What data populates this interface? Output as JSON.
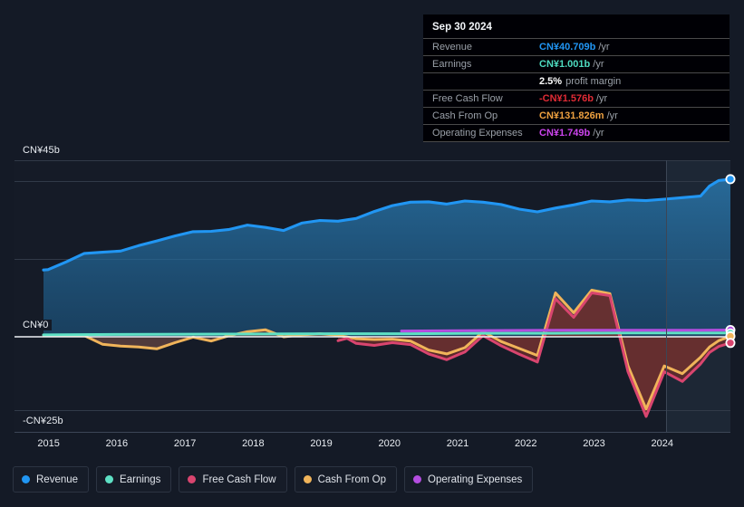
{
  "tooltip": {
    "date": "Sep 30 2024",
    "rows": [
      {
        "label": "Revenue",
        "value": "CN¥40.709b",
        "unit": "/yr",
        "color": "#2196f3"
      },
      {
        "label": "Earnings",
        "value": "CN¥1.001b",
        "unit": "/yr",
        "color": "#4ddbc0"
      },
      {
        "label": "",
        "value": "2.5%",
        "unit": "",
        "sub": "profit margin",
        "color": "#ffffff"
      },
      {
        "label": "Free Cash Flow",
        "value": "-CN¥1.576b",
        "unit": "/yr",
        "color": "#e02b35"
      },
      {
        "label": "Cash From Op",
        "value": "CN¥131.826m",
        "unit": "/yr",
        "color": "#eea140"
      },
      {
        "label": "Operating Expenses",
        "value": "CN¥1.749b",
        "unit": "/yr",
        "color": "#cc44ee"
      }
    ]
  },
  "legend": {
    "items": [
      {
        "label": "Revenue",
        "color": "#2196f3"
      },
      {
        "label": "Earnings",
        "color": "#5ee0c4"
      },
      {
        "label": "Free Cash Flow",
        "color": "#d9456f"
      },
      {
        "label": "Cash From Op",
        "color": "#f0b45a"
      },
      {
        "label": "Operating Expenses",
        "color": "#b44de0"
      }
    ]
  },
  "axes": {
    "y_top_label": "CN¥45b",
    "y_zero_label": "CN¥0",
    "y_bottom_label": "-CN¥25b",
    "x_labels": [
      "2015",
      "2016",
      "2017",
      "2018",
      "2019",
      "2020",
      "2021",
      "2022",
      "2023",
      "2024"
    ]
  },
  "chart_data": {
    "type": "area",
    "title": "",
    "xlabel": "",
    "ylabel": "CN¥",
    "ylim": [
      -25,
      45
    ],
    "y_ticks": [
      45,
      0,
      -25
    ],
    "y_tick_labels": [
      "CN¥45b",
      "CN¥0",
      "-CN¥25b"
    ],
    "xlim": [
      2014.5,
      2025.0
    ],
    "x_ticks": [
      2015,
      2016,
      2017,
      2018,
      2019,
      2020,
      2021,
      2022,
      2023,
      2024
    ],
    "grid": true,
    "legend_position": "bottom",
    "currency": "CN¥",
    "units": "billions",
    "highlight_region_start": 2023.8,
    "series": [
      {
        "name": "Revenue",
        "color": "#2196f3",
        "fill": true,
        "x": [
          2014.75,
          2015.0,
          2015.25,
          2015.5,
          2015.75,
          2016.0,
          2016.25,
          2016.5,
          2016.75,
          2017.0,
          2017.25,
          2017.5,
          2017.75,
          2018.0,
          2018.25,
          2018.5,
          2018.75,
          2019.0,
          2019.25,
          2019.5,
          2019.75,
          2020.0,
          2020.25,
          2020.5,
          2020.75,
          2021.0,
          2021.25,
          2021.5,
          2021.75,
          2022.0,
          2022.25,
          2022.5,
          2022.75,
          2023.0,
          2023.25,
          2023.5,
          2023.75,
          2024.0,
          2024.25,
          2024.5,
          2024.75
        ],
        "values": [
          17.3,
          17.4,
          19.4,
          21.6,
          21.9,
          22.2,
          23.6,
          24.8,
          26.1,
          27.2,
          27.3,
          27.8,
          28.9,
          28.3,
          27.5,
          29.4,
          30.1,
          29.9,
          30.6,
          32.4,
          33.9,
          34.8,
          34.9,
          34.3,
          35.1,
          34.8,
          34.2,
          33.0,
          32.3,
          33.3,
          34.1,
          35.1,
          34.9,
          35.4,
          35.2,
          35.6,
          36.0,
          36.4,
          39.0,
          40.4,
          40.709
        ]
      },
      {
        "name": "Earnings",
        "color": "#5ee0c4",
        "fill": false,
        "x": [
          2014.75,
          2016.0,
          2017.5,
          2019.0,
          2020.0,
          2021.0,
          2022.0,
          2023.0,
          2024.0,
          2024.75
        ],
        "values": [
          0.5,
          0.6,
          0.7,
          0.8,
          0.8,
          0.9,
          0.9,
          1.0,
          1.0,
          1.001
        ]
      },
      {
        "name": "Free Cash Flow",
        "color": "#d9456f",
        "fill": true,
        "x": [
          2018.75,
          2019.0,
          2019.25,
          2019.5,
          2019.75,
          2020.0,
          2020.25,
          2020.5,
          2020.75,
          2021.0,
          2021.25,
          2021.5,
          2021.75,
          2022.0,
          2022.25,
          2022.5,
          2022.75,
          2023.0,
          2023.25,
          2023.5,
          2023.75,
          2024.0,
          2024.25,
          2024.5,
          2024.75
        ],
        "values": [
          -1.0,
          -0.4,
          -1.7,
          -2.2,
          -1.5,
          -2.0,
          -4.4,
          -5.9,
          -3.9,
          0.3,
          -2.3,
          -4.5,
          -6.5,
          9.8,
          5.0,
          11.3,
          10.6,
          -9.0,
          -20.5,
          -9.0,
          -11.5,
          -7.0,
          -4.0,
          -2.5,
          -1.576
        ]
      },
      {
        "name": "Cash From Op",
        "color": "#f0b45a",
        "fill": true,
        "x": [
          2014.75,
          2015.0,
          2015.25,
          2015.5,
          2015.75,
          2016.0,
          2016.25,
          2016.5,
          2016.75,
          2017.0,
          2017.25,
          2017.5,
          2017.75,
          2018.0,
          2018.25,
          2018.5,
          2018.75,
          2019.0,
          2019.25,
          2019.5,
          2019.75,
          2020.0,
          2020.25,
          2020.5,
          2020.75,
          2021.0,
          2021.25,
          2021.5,
          2021.75,
          2022.0,
          2022.25,
          2022.5,
          2022.75,
          2023.0,
          2023.25,
          2023.5,
          2023.75,
          2024.0,
          2024.25,
          2024.5,
          2024.75
        ],
        "values": [
          0.4,
          0.4,
          0.4,
          0.3,
          -1.9,
          -2.4,
          -2.6,
          -3.1,
          -1.5,
          -0.1,
          -1.1,
          0.3,
          1.3,
          1.8,
          0.0,
          0.5,
          0.8,
          0.4,
          -0.5,
          -0.7,
          -0.6,
          -1.1,
          -3.4,
          -4.4,
          -2.8,
          1.3,
          -1.2,
          -3.0,
          -4.8,
          11.3,
          6.2,
          12.0,
          11.1,
          -7.5,
          -18.6,
          -7.5,
          -9.5,
          -5.3,
          -2.6,
          -1.0,
          0.13
        ]
      },
      {
        "name": "Operating Expenses",
        "color": "#b44de0",
        "fill": false,
        "x": [
          2020.0,
          2021.0,
          2022.0,
          2023.0,
          2024.0,
          2024.75
        ],
        "values": [
          1.5,
          1.6,
          1.7,
          1.7,
          1.7,
          1.749
        ]
      }
    ]
  }
}
